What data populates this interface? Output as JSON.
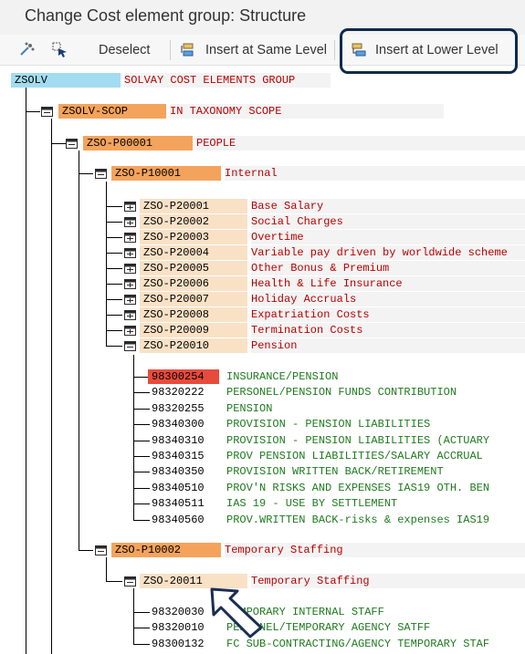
{
  "title": "Change Cost element group: Structure",
  "toolbar": {
    "deselect": "Deselect",
    "insert_same": "Insert at Same Level",
    "insert_lower": "Insert at Lower Level"
  },
  "colors": {
    "root_code_bg": "#a3dcf0",
    "level1_bg": "#f4a35c",
    "level3_bg": "#f9e1c6",
    "selected_bg": "#e84b3c",
    "node_text": "#b80000",
    "leaf_text": "#1f7a1f",
    "highlight_border": "#0e2a4a"
  },
  "tree": {
    "root": {
      "code": "ZSOLV",
      "desc": "SOLVAY COST ELEMENTS GROUP"
    },
    "scope": {
      "code": "ZSOLV-SCOP",
      "desc": "IN TAXONOMY SCOPE"
    },
    "people": {
      "code": "ZSO-P00001",
      "desc": "PEOPLE"
    },
    "internal": {
      "code": "ZSO-P10001",
      "desc": "Internal"
    },
    "groups": [
      {
        "code": "ZSO-P20001",
        "desc": "Base Salary"
      },
      {
        "code": "ZSO-P20002",
        "desc": "Social Charges"
      },
      {
        "code": "ZSO-P20003",
        "desc": "Overtime"
      },
      {
        "code": "ZSO-P20004",
        "desc": "Variable pay driven by worldwide scheme"
      },
      {
        "code": "ZSO-P20005",
        "desc": "Other Bonus & Premium"
      },
      {
        "code": "ZSO-P20006",
        "desc": "Health & Life Insurance"
      },
      {
        "code": "ZSO-P20007",
        "desc": "Holiday Accruals"
      },
      {
        "code": "ZSO-P20008",
        "desc": "Expatriation Costs"
      },
      {
        "code": "ZSO-P20009",
        "desc": "Termination Costs"
      },
      {
        "code": "ZSO-P20010",
        "desc": "Pension"
      }
    ],
    "pension_items": [
      {
        "code": "98300254",
        "desc": "INSURANCE/PENSION"
      },
      {
        "code": "98320222",
        "desc": "PERSONEL/PENSION FUNDS CONTRIBUTION"
      },
      {
        "code": "98320255",
        "desc": "PENSION"
      },
      {
        "code": "98340300",
        "desc": "PROVISION - PENSION LIABILITIES"
      },
      {
        "code": "98340310",
        "desc": "PROVISION - PENSION LIABILITIES (ACTUARY"
      },
      {
        "code": "98340315",
        "desc": "PROV PENSION LIABILITIES/SALARY ACCRUAL"
      },
      {
        "code": "98340350",
        "desc": "PROVISION WRITTEN BACK/RETIREMENT"
      },
      {
        "code": "98340510",
        "desc": "PROV'N RISKS AND EXPENSES IAS19 OTH. BEN"
      },
      {
        "code": "98340511",
        "desc": "IAS 19 - USE BY SETTLEMENT"
      },
      {
        "code": "98340560",
        "desc": "PROV.WRITTEN BACK-risks & expenses IAS19"
      }
    ],
    "temp": {
      "code": "ZSO-P10002",
      "desc": "Temporary Staffing"
    },
    "temp_group": {
      "code": "ZSO-20011",
      "desc": "Temporary Staffing"
    },
    "temp_items": [
      {
        "code": "98320030",
        "desc": "TEMPORARY INTERNAL STAFF"
      },
      {
        "code": "98320010",
        "desc": "PERSONEL/TEMPORARY AGENCY SATFF"
      },
      {
        "code": "98300132",
        "desc": "FC SUB-CONTRACTING/AGENCY TEMPORARY STAF"
      }
    ]
  }
}
